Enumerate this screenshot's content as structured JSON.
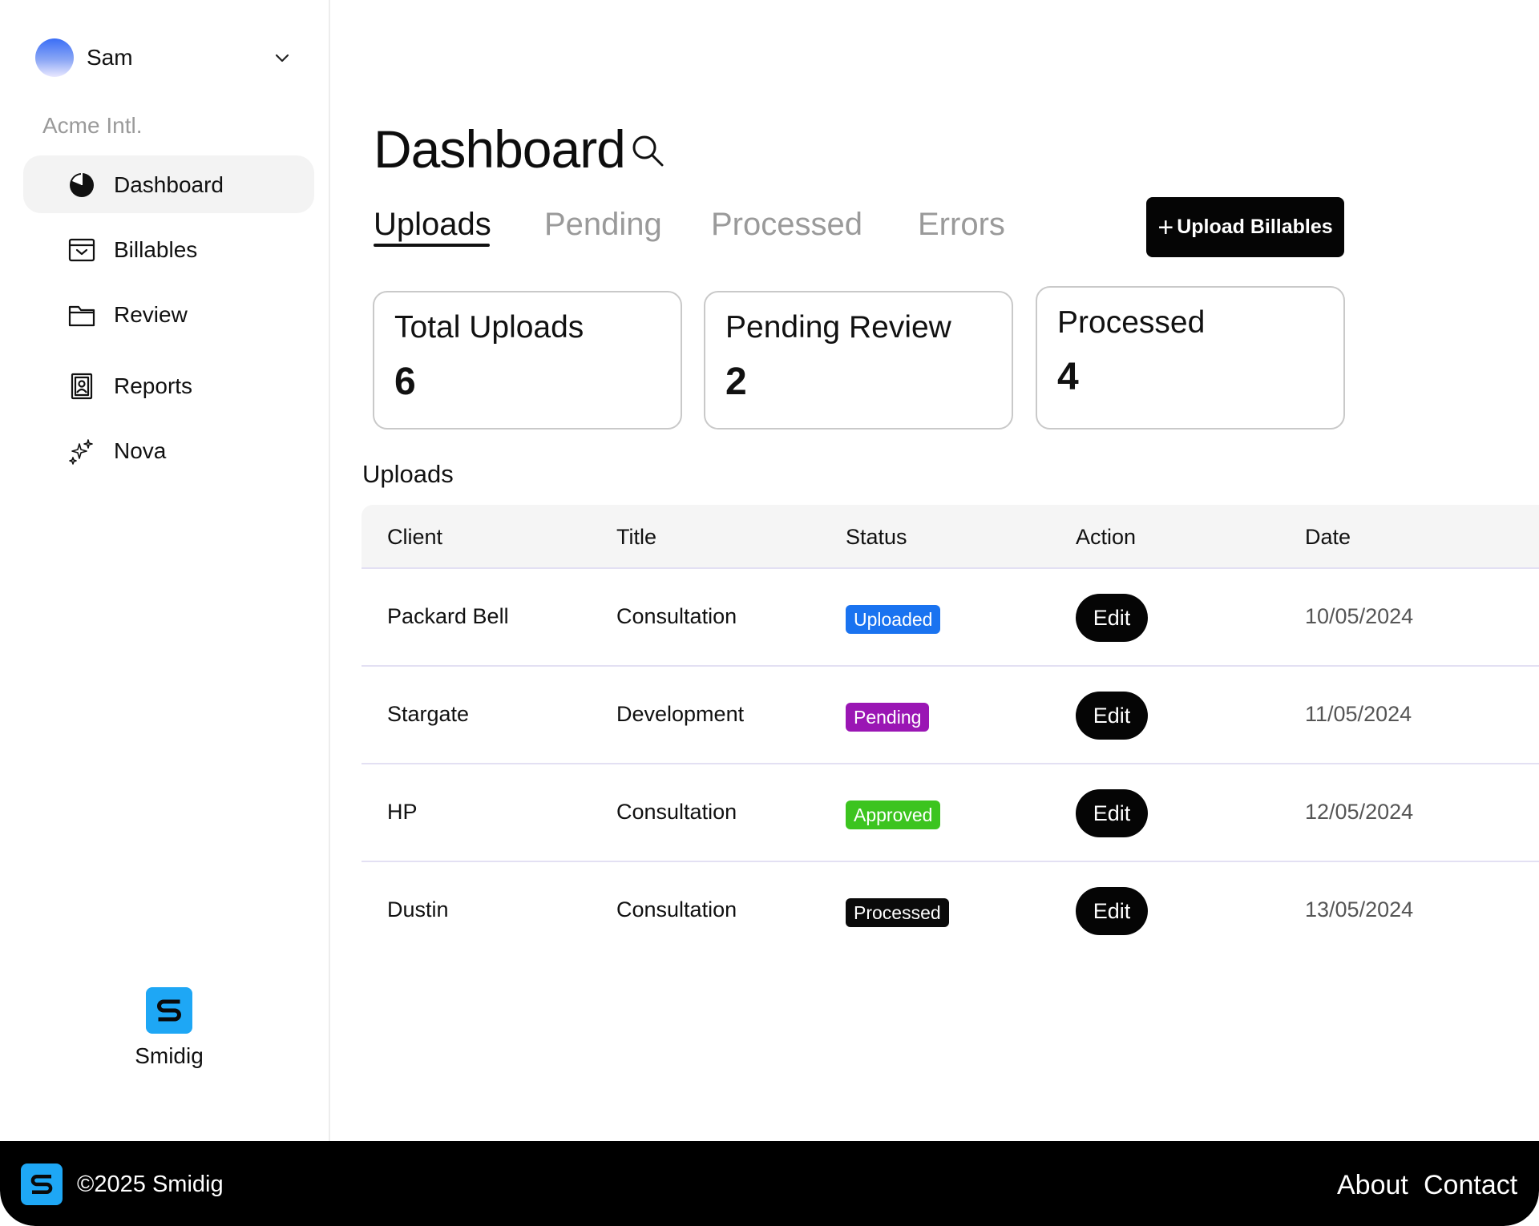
{
  "user": {
    "name": "Sam"
  },
  "org": {
    "name": "Acme Intl."
  },
  "sidebar": {
    "items": [
      {
        "label": "Dashboard",
        "icon": "pie-chart-icon"
      },
      {
        "label": "Billables",
        "icon": "archive-box-icon"
      },
      {
        "label": "Review",
        "icon": "folder-icon"
      },
      {
        "label": "Reports",
        "icon": "contact-card-icon"
      },
      {
        "label": "Nova",
        "icon": "sparkles-icon"
      }
    ]
  },
  "brand": {
    "name": "Smidig"
  },
  "page": {
    "title": "Dashboard"
  },
  "tabs": [
    {
      "label": "Uploads"
    },
    {
      "label": "Pending"
    },
    {
      "label": "Processed"
    },
    {
      "label": "Errors"
    }
  ],
  "actions": {
    "upload_label": "Upload Billables",
    "upload_icon": "plus-icon"
  },
  "stats": [
    {
      "label": "Total Uploads",
      "value": "6"
    },
    {
      "label": "Pending Review",
      "value": "2"
    },
    {
      "label": "Processed",
      "value": "4"
    }
  ],
  "uploads": {
    "title": "Uploads",
    "columns": [
      "Client",
      "Title",
      "Status",
      "Action",
      "Date"
    ],
    "rows": [
      {
        "client": "Packard Bell",
        "title": "Consultation",
        "status": "Uploaded",
        "action": "Edit",
        "date": "10/05/2024"
      },
      {
        "client": "Stargate",
        "title": "Development",
        "status": "Pending",
        "action": "Edit",
        "date": "11/05/2024"
      },
      {
        "client": "HP",
        "title": "Consultation",
        "status": "Approved",
        "action": "Edit",
        "date": "12/05/2024"
      },
      {
        "client": "Dustin",
        "title": "Consultation",
        "status": "Processed",
        "action": "Edit",
        "date": "13/05/2024"
      }
    ]
  },
  "status_colors": {
    "Uploaded": "#1a73f0",
    "Pending": "#9a16b4",
    "Approved": "#3cc41f",
    "Processed": "#0a0a0a"
  },
  "footer": {
    "copyright": "©2025 Smidig",
    "links": [
      "About",
      "Contact"
    ]
  }
}
